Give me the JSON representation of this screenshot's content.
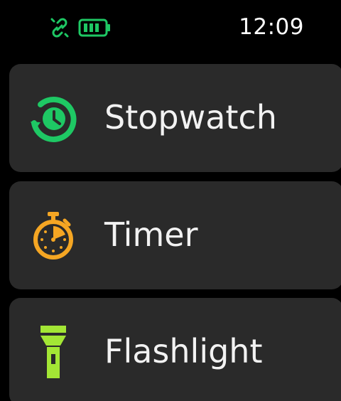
{
  "status_bar": {
    "time": "12:09",
    "icons": [
      "link-disconnected-icon",
      "battery-icon"
    ],
    "colors": {
      "link": "#1ec864",
      "battery": "#1ec864"
    }
  },
  "menu": {
    "items": [
      {
        "label": "Stopwatch",
        "icon": "stopwatch-icon",
        "color": "#1ec864"
      },
      {
        "label": "Timer",
        "icon": "timer-icon",
        "color": "#f5a623"
      },
      {
        "label": "Flashlight",
        "icon": "flashlight-icon",
        "color": "#a3e635"
      }
    ]
  }
}
